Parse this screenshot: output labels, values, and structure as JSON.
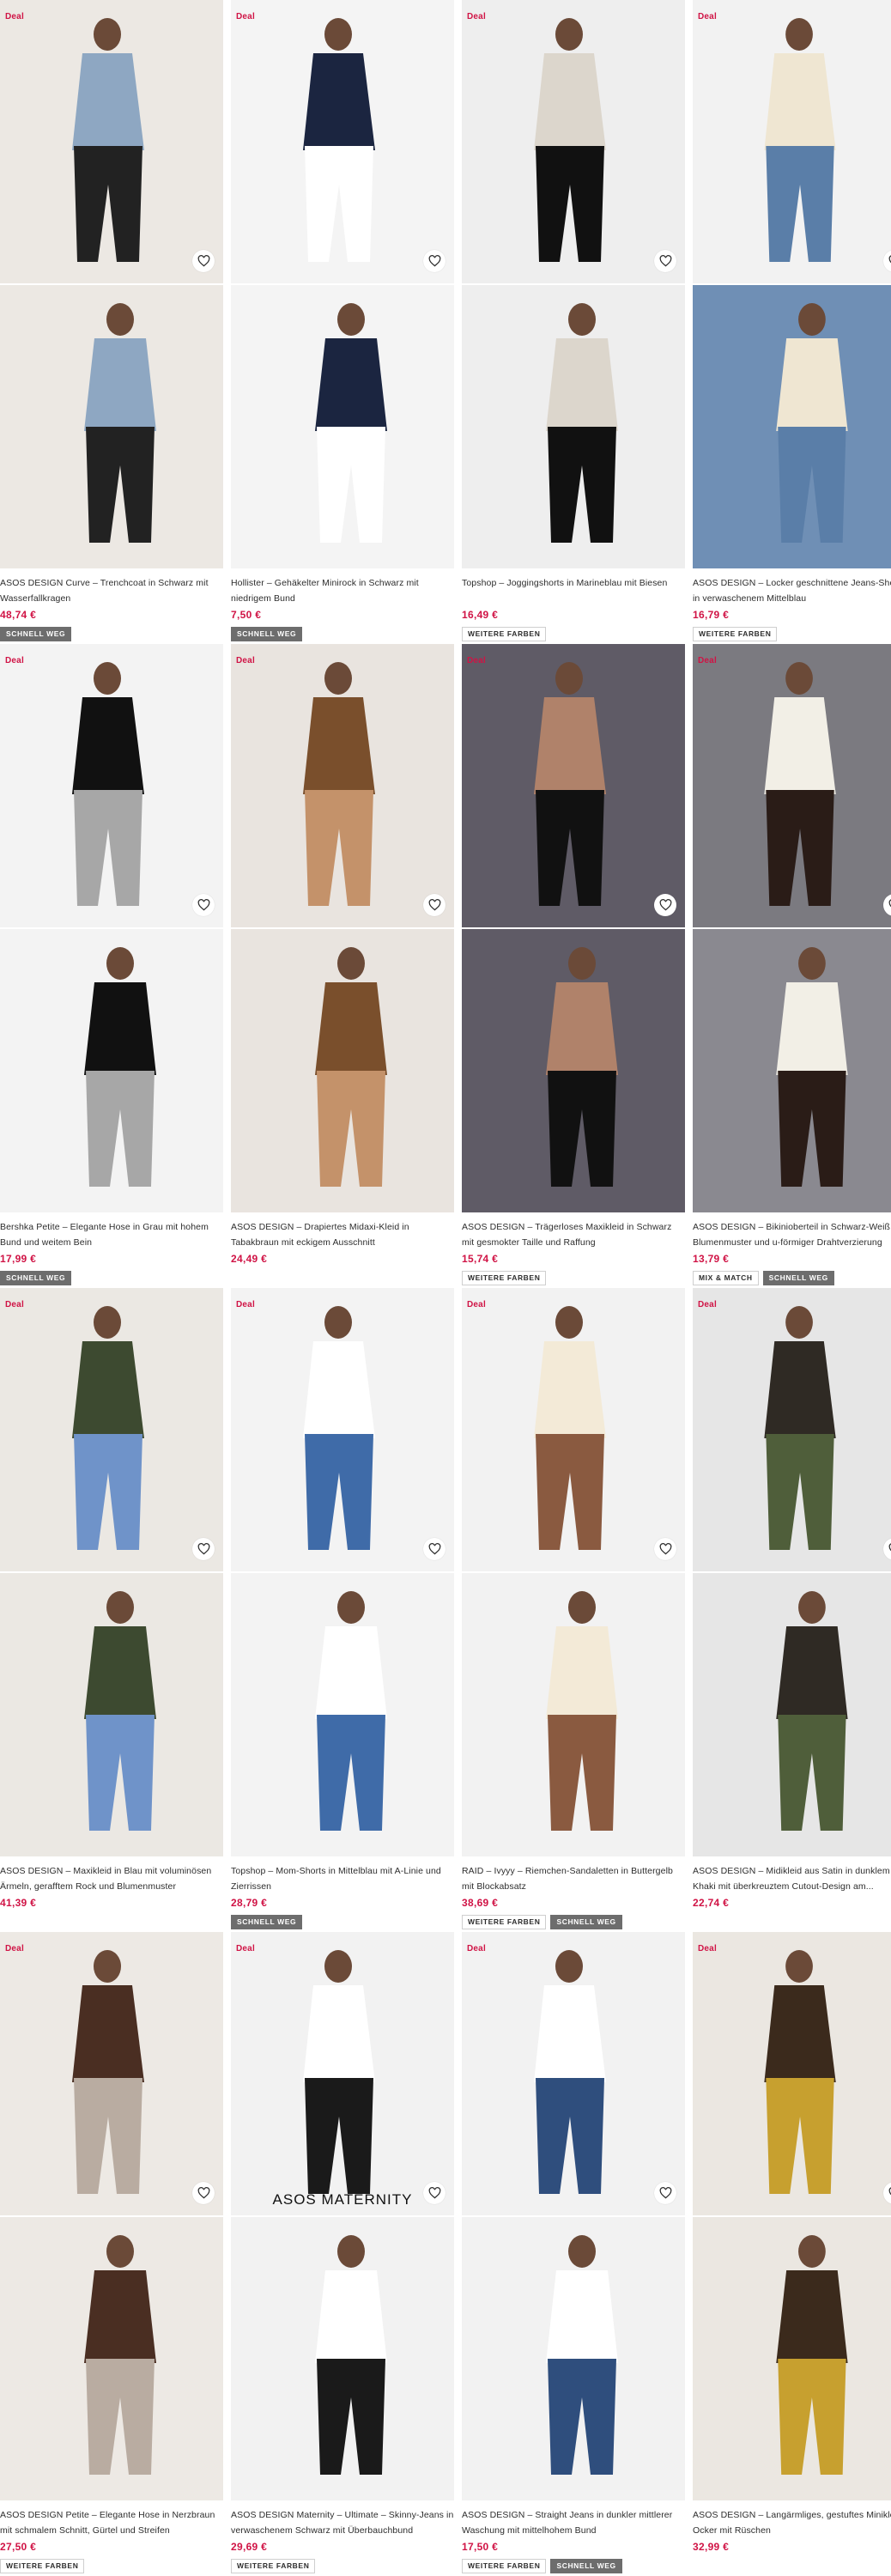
{
  "icons": {
    "wishlist": "heart-outline-icon"
  },
  "colors": {
    "deal": "#d01345",
    "price": "#d01345",
    "badge_dark": "#6d6d6d"
  },
  "products": [
    {
      "deal": "Deal",
      "title": "ASOS DESIGN Curve – Trenchcoat in Schwarz mit Wasserfallkragen",
      "price": "48,74 €",
      "badges": [
        "SCHNELL WEG"
      ],
      "bg": "#ece8e3",
      "figure": "#222222",
      "accent": "#8ea7c2",
      "bg2": "#ece8e3"
    },
    {
      "deal": "Deal",
      "title": "Hollister – Gehäkelter Minirock in Schwarz mit niedrigem Bund",
      "price": "7,50 €",
      "badges": [
        "SCHNELL WEG"
      ],
      "bg": "#f4f4f4",
      "figure": "#ffffff",
      "accent": "#1b2540",
      "bg2": "#f4f4f4"
    },
    {
      "deal": "Deal",
      "title": "Topshop – Joggingshorts in Marineblau mit Biesen",
      "price": "16,49 €",
      "badges": [
        "WEITERE FARBEN"
      ],
      "bg": "#eeeeee",
      "figure": "#111111",
      "accent": "#dcd6cc",
      "bg2": "#eeeeee"
    },
    {
      "deal": "Deal",
      "title": "ASOS DESIGN – Locker geschnittene Jeans-Shorts in verwaschenem Mittelblau",
      "price": "16,79 €",
      "badges": [
        "WEITERE FARBEN"
      ],
      "bg": "#f2f2f2",
      "figure": "#5a7ea8",
      "accent": "#efe6d2",
      "bg2": "#6f8fb5"
    },
    {
      "deal": "Deal",
      "title": "Bershka Petite – Elegante Hose in Grau mit hohem Bund und weitem Bein",
      "price": "17,99 €",
      "badges": [
        "SCHNELL WEG"
      ],
      "bg": "#f3f3f3",
      "figure": "#a7a7a7",
      "accent": "#111111",
      "bg2": "#f3f3f3"
    },
    {
      "deal": "Deal",
      "title": "ASOS DESIGN – Drapiertes Midaxi-Kleid in Tabakbraun mit eckigem Ausschnitt",
      "price": "24,49 €",
      "badges": [],
      "bg": "#e9e4df",
      "figure": "#c4926a",
      "accent": "#7a4f2c",
      "bg2": "#e9e4df"
    },
    {
      "deal": "Deal",
      "title": "ASOS DESIGN – Trägerloses Maxikleid in Schwarz mit gesmokter Taille und Raffung",
      "price": "15,74 €",
      "badges": [
        "WEITERE FARBEN"
      ],
      "bg": "#5f5b66",
      "figure": "#111111",
      "accent": "#b0826a",
      "bg2": "#5f5b66"
    },
    {
      "deal": "Deal",
      "title": "ASOS DESIGN – Bikinioberteil in Schwarz-Weiß mit Blumenmuster und u-förmiger Drahtverzierung",
      "price": "13,79 €",
      "badges": [
        "MIX & MATCH",
        "SCHNELL WEG"
      ],
      "bg": "#7b7a80",
      "figure": "#2a1c17",
      "accent": "#f2efe6",
      "bg2": "#8a8990"
    },
    {
      "deal": "Deal",
      "title": "ASOS DESIGN – Maxikleid in Blau mit voluminösen Ärmeln, gerafftem Rock und Blumenmuster",
      "price": "41,39 €",
      "badges": [],
      "bg": "#ebe8e3",
      "figure": "#6f93c9",
      "accent": "#3d4a30",
      "bg2": "#ebe8e3"
    },
    {
      "deal": "Deal",
      "title": "Topshop – Mom-Shorts in Mittelblau mit A-Linie und Zierrissen",
      "price": "28,79 €",
      "badges": [
        "SCHNELL WEG"
      ],
      "bg": "#f3f3f3",
      "figure": "#3f6ba8",
      "accent": "#ffffff",
      "bg2": "#f3f3f3"
    },
    {
      "deal": "Deal",
      "title": "RAID – Ivyyy – Riemchen-Sandaletten in Buttergelb mit Blockabsatz",
      "price": "38,69 €",
      "badges": [
        "WEITERE FARBEN",
        "SCHNELL WEG"
      ],
      "bg": "#f2f2f2",
      "figure": "#8a5a40",
      "accent": "#f3ead7",
      "bg2": "#f2f2f2"
    },
    {
      "deal": "Deal",
      "title": "ASOS DESIGN – Midikleid aus Satin in dunklem Khaki mit überkreuztem Cutout-Design am...",
      "price": "22,74 €",
      "badges": [],
      "bg": "#e6e6e6",
      "figure": "#4f5e3a",
      "accent": "#2f2a24",
      "bg2": "#e6e6e6"
    },
    {
      "deal": "Deal",
      "title": "ASOS DESIGN Petite – Elegante Hose in Nerzbraun mit schmalem Schnitt, Gürtel und Streifen",
      "price": "27,50 €",
      "badges": [
        "WEITERE FARBEN"
      ],
      "bg": "#ede9e4",
      "figure": "#b9aca1",
      "accent": "#4a2e22",
      "bg2": "#ede9e4"
    },
    {
      "deal": "Deal",
      "title": "ASOS DESIGN Maternity – Ultimate – Skinny-Jeans in verwaschenem Schwarz mit Überbauchbund",
      "price": "29,69 €",
      "badges": [
        "WEITERE FARBEN"
      ],
      "bg": "#f2f2f2",
      "figure": "#1a1a1a",
      "accent": "#ffffff",
      "bg2": "#f2f2f2",
      "overlay": "ASOS MATERNITY"
    },
    {
      "deal": "Deal",
      "title": "ASOS DESIGN – Straight Jeans in dunkler mittlerer Waschung mit mittelhohem Bund",
      "price": "17,50 €",
      "badges": [
        "WEITERE FARBEN",
        "SCHNELL WEG"
      ],
      "bg": "#f2f2f2",
      "figure": "#2f4e7d",
      "accent": "#ffffff",
      "bg2": "#f2f2f2"
    },
    {
      "deal": "Deal",
      "title": "ASOS DESIGN – Langärmliges, gestuftes Minikleid in Ocker mit Rüschen",
      "price": "32,99 €",
      "badges": [],
      "bg": "#ebe7e1",
      "figure": "#c7a02f",
      "accent": "#3b2a1c",
      "bg2": "#ebe7e1"
    }
  ]
}
